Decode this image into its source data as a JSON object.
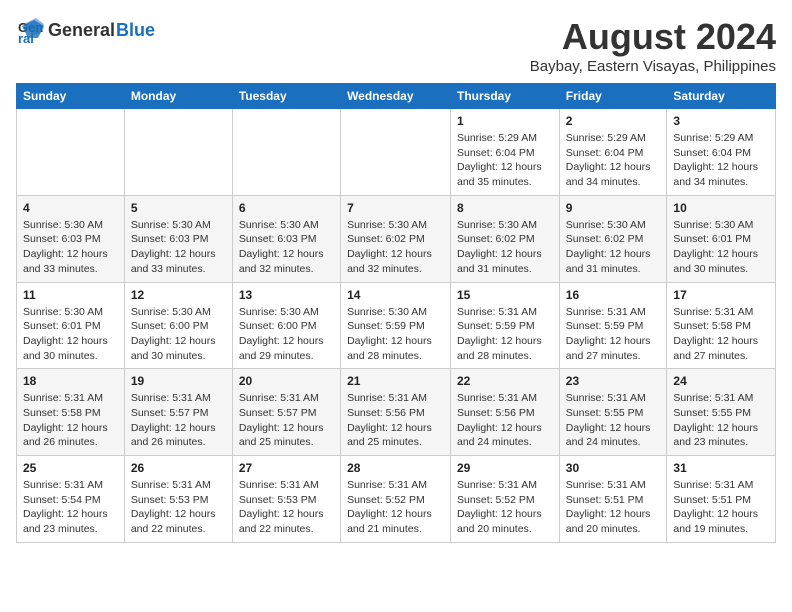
{
  "header": {
    "logo_line1": "General",
    "logo_line2": "Blue",
    "main_title": "August 2024",
    "subtitle": "Baybay, Eastern Visayas, Philippines"
  },
  "days_of_week": [
    "Sunday",
    "Monday",
    "Tuesday",
    "Wednesday",
    "Thursday",
    "Friday",
    "Saturday"
  ],
  "weeks": [
    [
      {
        "day": "",
        "info": ""
      },
      {
        "day": "",
        "info": ""
      },
      {
        "day": "",
        "info": ""
      },
      {
        "day": "",
        "info": ""
      },
      {
        "day": "1",
        "info": "Sunrise: 5:29 AM\nSunset: 6:04 PM\nDaylight: 12 hours\nand 35 minutes."
      },
      {
        "day": "2",
        "info": "Sunrise: 5:29 AM\nSunset: 6:04 PM\nDaylight: 12 hours\nand 34 minutes."
      },
      {
        "day": "3",
        "info": "Sunrise: 5:29 AM\nSunset: 6:04 PM\nDaylight: 12 hours\nand 34 minutes."
      }
    ],
    [
      {
        "day": "4",
        "info": "Sunrise: 5:30 AM\nSunset: 6:03 PM\nDaylight: 12 hours\nand 33 minutes."
      },
      {
        "day": "5",
        "info": "Sunrise: 5:30 AM\nSunset: 6:03 PM\nDaylight: 12 hours\nand 33 minutes."
      },
      {
        "day": "6",
        "info": "Sunrise: 5:30 AM\nSunset: 6:03 PM\nDaylight: 12 hours\nand 32 minutes."
      },
      {
        "day": "7",
        "info": "Sunrise: 5:30 AM\nSunset: 6:02 PM\nDaylight: 12 hours\nand 32 minutes."
      },
      {
        "day": "8",
        "info": "Sunrise: 5:30 AM\nSunset: 6:02 PM\nDaylight: 12 hours\nand 31 minutes."
      },
      {
        "day": "9",
        "info": "Sunrise: 5:30 AM\nSunset: 6:02 PM\nDaylight: 12 hours\nand 31 minutes."
      },
      {
        "day": "10",
        "info": "Sunrise: 5:30 AM\nSunset: 6:01 PM\nDaylight: 12 hours\nand 30 minutes."
      }
    ],
    [
      {
        "day": "11",
        "info": "Sunrise: 5:30 AM\nSunset: 6:01 PM\nDaylight: 12 hours\nand 30 minutes."
      },
      {
        "day": "12",
        "info": "Sunrise: 5:30 AM\nSunset: 6:00 PM\nDaylight: 12 hours\nand 30 minutes."
      },
      {
        "day": "13",
        "info": "Sunrise: 5:30 AM\nSunset: 6:00 PM\nDaylight: 12 hours\nand 29 minutes."
      },
      {
        "day": "14",
        "info": "Sunrise: 5:30 AM\nSunset: 5:59 PM\nDaylight: 12 hours\nand 28 minutes."
      },
      {
        "day": "15",
        "info": "Sunrise: 5:31 AM\nSunset: 5:59 PM\nDaylight: 12 hours\nand 28 minutes."
      },
      {
        "day": "16",
        "info": "Sunrise: 5:31 AM\nSunset: 5:59 PM\nDaylight: 12 hours\nand 27 minutes."
      },
      {
        "day": "17",
        "info": "Sunrise: 5:31 AM\nSunset: 5:58 PM\nDaylight: 12 hours\nand 27 minutes."
      }
    ],
    [
      {
        "day": "18",
        "info": "Sunrise: 5:31 AM\nSunset: 5:58 PM\nDaylight: 12 hours\nand 26 minutes."
      },
      {
        "day": "19",
        "info": "Sunrise: 5:31 AM\nSunset: 5:57 PM\nDaylight: 12 hours\nand 26 minutes."
      },
      {
        "day": "20",
        "info": "Sunrise: 5:31 AM\nSunset: 5:57 PM\nDaylight: 12 hours\nand 25 minutes."
      },
      {
        "day": "21",
        "info": "Sunrise: 5:31 AM\nSunset: 5:56 PM\nDaylight: 12 hours\nand 25 minutes."
      },
      {
        "day": "22",
        "info": "Sunrise: 5:31 AM\nSunset: 5:56 PM\nDaylight: 12 hours\nand 24 minutes."
      },
      {
        "day": "23",
        "info": "Sunrise: 5:31 AM\nSunset: 5:55 PM\nDaylight: 12 hours\nand 24 minutes."
      },
      {
        "day": "24",
        "info": "Sunrise: 5:31 AM\nSunset: 5:55 PM\nDaylight: 12 hours\nand 23 minutes."
      }
    ],
    [
      {
        "day": "25",
        "info": "Sunrise: 5:31 AM\nSunset: 5:54 PM\nDaylight: 12 hours\nand 23 minutes."
      },
      {
        "day": "26",
        "info": "Sunrise: 5:31 AM\nSunset: 5:53 PM\nDaylight: 12 hours\nand 22 minutes."
      },
      {
        "day": "27",
        "info": "Sunrise: 5:31 AM\nSunset: 5:53 PM\nDaylight: 12 hours\nand 22 minutes."
      },
      {
        "day": "28",
        "info": "Sunrise: 5:31 AM\nSunset: 5:52 PM\nDaylight: 12 hours\nand 21 minutes."
      },
      {
        "day": "29",
        "info": "Sunrise: 5:31 AM\nSunset: 5:52 PM\nDaylight: 12 hours\nand 20 minutes."
      },
      {
        "day": "30",
        "info": "Sunrise: 5:31 AM\nSunset: 5:51 PM\nDaylight: 12 hours\nand 20 minutes."
      },
      {
        "day": "31",
        "info": "Sunrise: 5:31 AM\nSunset: 5:51 PM\nDaylight: 12 hours\nand 19 minutes."
      }
    ]
  ]
}
